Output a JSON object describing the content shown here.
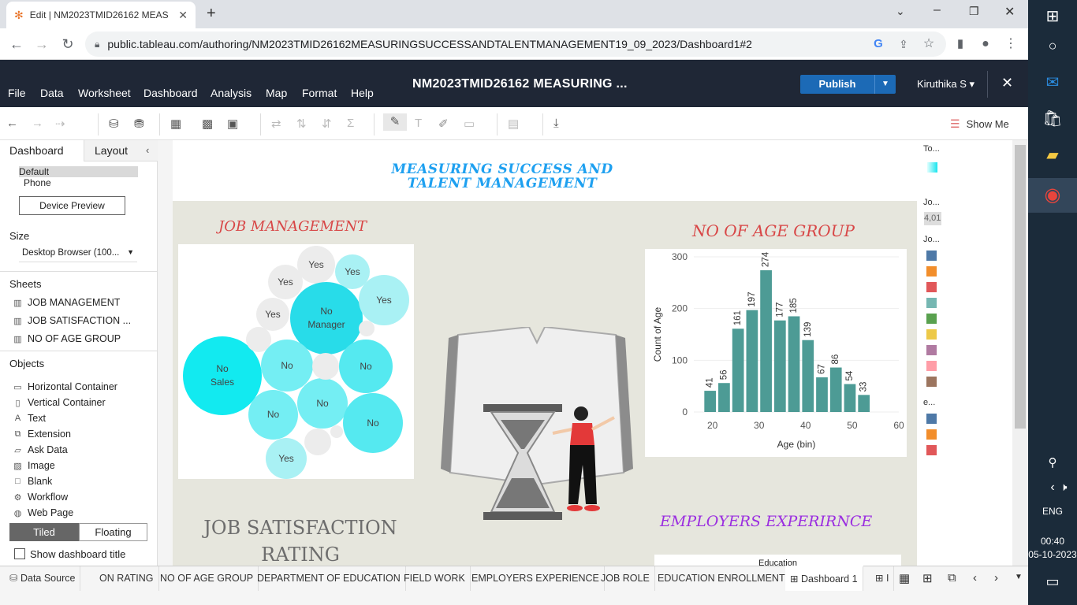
{
  "browser": {
    "tab_title": "Edit | NM2023TMID26162 MEAS",
    "url": "public.tableau.com/authoring/NM2023TMID26162MEASURINGSUCCESSANDTALENTMANAGEMENT19_09_2023/Dashboard1#2"
  },
  "tableau": {
    "menu": [
      "File",
      "Data",
      "Worksheet",
      "Dashboard",
      "Analysis",
      "Map",
      "Format",
      "Help"
    ],
    "title": "NM2023TMID26162 MEASURING ...",
    "publish": "Publish",
    "user": "Kiruthika S ▾",
    "show_me": "Show Me"
  },
  "leftpane": {
    "tab_dashboard": "Dashboard",
    "tab_layout": "Layout",
    "device_default": "Default",
    "device_phone": "Phone",
    "device_preview": "Device Preview",
    "size_label": "Size",
    "size_value": "Desktop Browser (100...",
    "sheets_label": "Sheets",
    "sheets": [
      "JOB MANAGEMENT",
      "JOB SATISFACTION ...",
      "NO OF AGE GROUP"
    ],
    "objects_label": "Objects",
    "objects": [
      "Horizontal Container",
      "Vertical Container",
      "Text",
      "Extension",
      "Ask Data",
      "Image",
      "Blank",
      "Workflow",
      "Web Page"
    ],
    "tiled": "Tiled",
    "floating": "Floating",
    "show_title": "Show dashboard title"
  },
  "dashboard": {
    "title_line1": "MEASURING SUCCESS AND",
    "title_line2": "TALENT MANAGEMENT",
    "job_mgmt_title": "JOB MANAGEMENT",
    "age_title": "NO OF AGE GROUP",
    "satisfaction_title_1": "JOB SATISFACTION",
    "satisfaction_title_2": "RATING",
    "employers_title": "EMPLOYERS EXPERIRNCE",
    "education_label": "Education",
    "bubbles": [
      {
        "l1": "Yes",
        "l2": ""
      },
      {
        "l1": "Yes",
        "l2": ""
      },
      {
        "l1": "Yes",
        "l2": ""
      },
      {
        "l1": "Yes",
        "l2": ""
      },
      {
        "l1": "No",
        "l2": "Manager"
      },
      {
        "l1": "Yes",
        "l2": ""
      },
      {
        "l1": "No",
        "l2": "Sales"
      },
      {
        "l1": "No",
        "l2": ""
      },
      {
        "l1": "No",
        "l2": ""
      },
      {
        "l1": "No",
        "l2": ""
      },
      {
        "l1": "No",
        "l2": ""
      },
      {
        "l1": "No",
        "l2": ""
      },
      {
        "l1": "Yes",
        "l2": ""
      }
    ]
  },
  "legend": {
    "header_to": "To...",
    "header_jo1": "Jo...",
    "value": "4,01",
    "header_jo2": "Jo...",
    "header_e": "e...",
    "colors_jo": [
      "#4e79a7",
      "#f28e2b",
      "#e15759",
      "#76b7b2",
      "#59a14f",
      "#edc948",
      "#b07aa1",
      "#ff9da7",
      "#9c755f"
    ],
    "colors_e": [
      "#4e79a7",
      "#f28e2b",
      "#e15759"
    ]
  },
  "chart_data": {
    "type": "bar",
    "title": "NO OF AGE GROUP",
    "xlabel": "Age (bin)",
    "ylabel": "Count of Age",
    "x": [
      20,
      25,
      30,
      35,
      40,
      45,
      50,
      55,
      60
    ],
    "x_bins": [
      18,
      21,
      24,
      27,
      30,
      33,
      36,
      39,
      42,
      45,
      48,
      51,
      54,
      57
    ],
    "values": [
      41,
      56,
      161,
      197,
      274,
      177,
      185,
      139,
      67,
      86,
      54,
      33
    ],
    "xticks": [
      20,
      30,
      40,
      50,
      60
    ],
    "yticks": [
      0,
      100,
      200,
      300
    ],
    "ylim": [
      0,
      300
    ],
    "color": "#4d9b95"
  },
  "bottom_tabs": [
    "Data Source",
    "ON RATING",
    "NO OF AGE GROUP",
    "DEPARTMENT OF EDUCATION",
    "FIELD WORK",
    "EMPLOYERS EXPERIENCE",
    "JOB ROLE",
    "EDUCATION ENROLLMENT",
    "Dashboard 1"
  ],
  "taskbar": {
    "lang": "ENG",
    "time": "00:40",
    "date": "05-10-2023"
  }
}
